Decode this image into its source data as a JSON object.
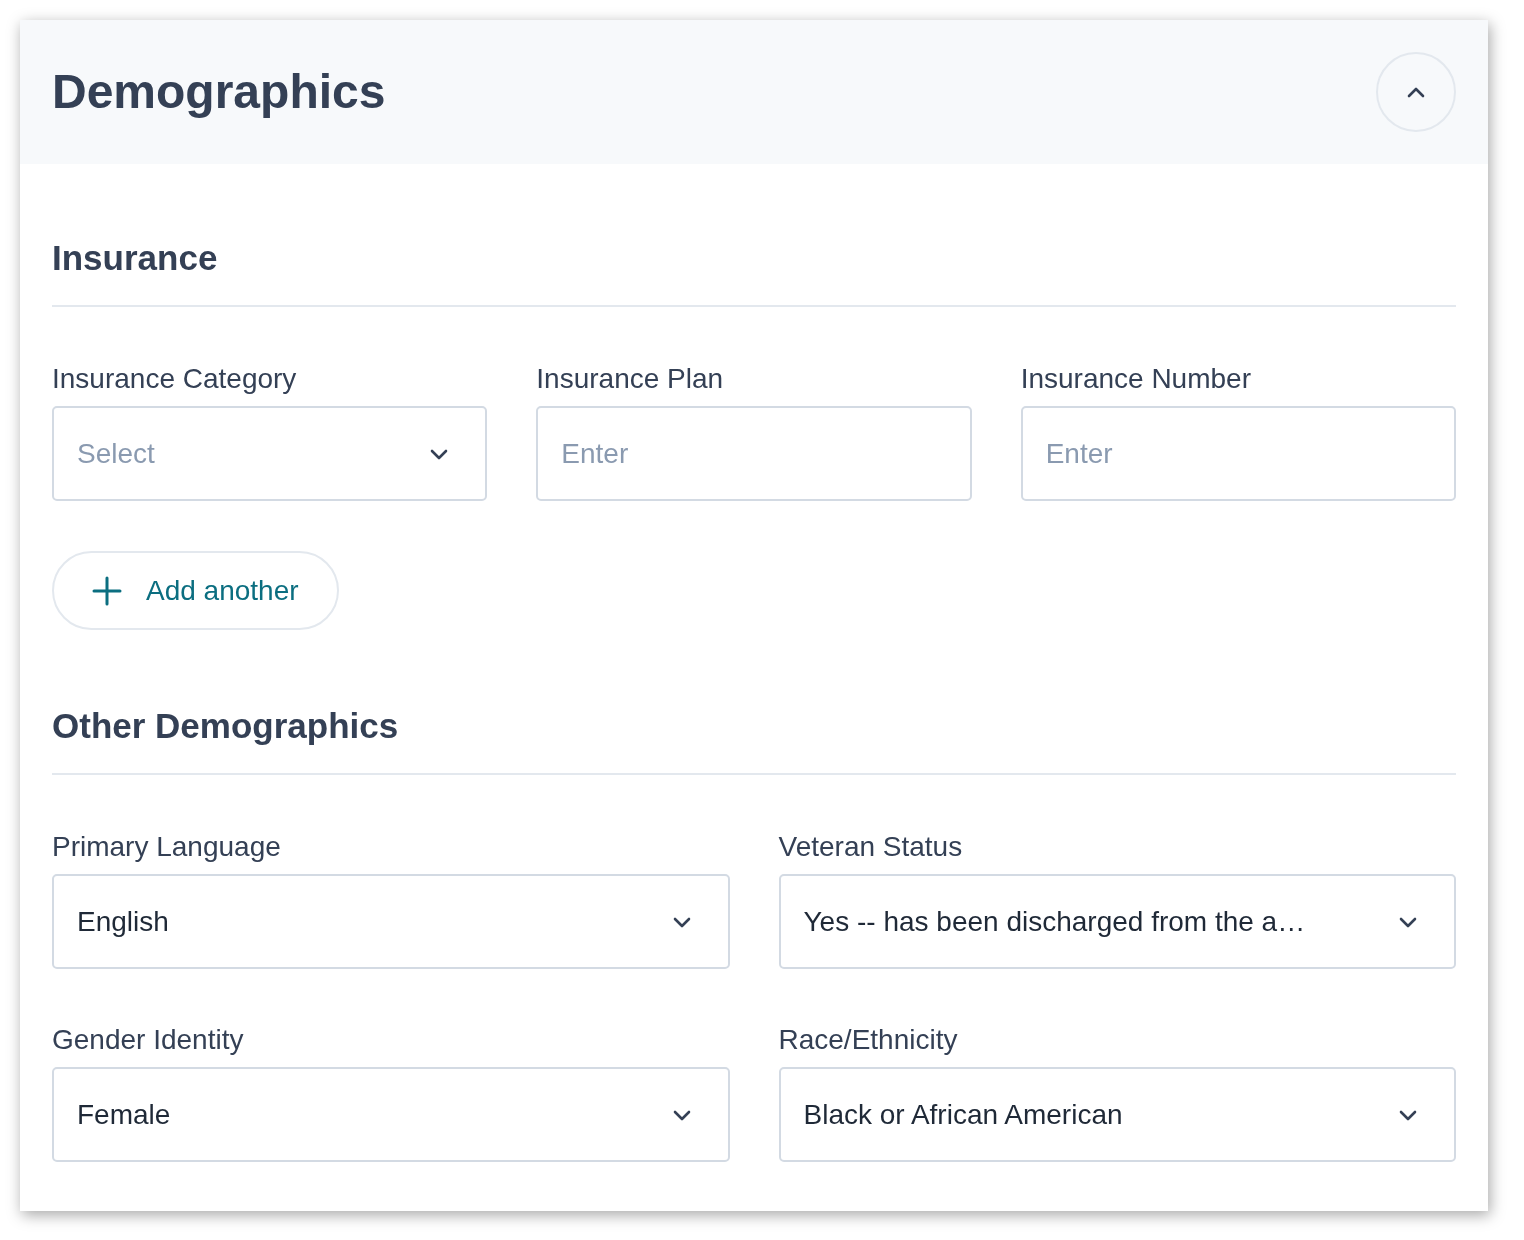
{
  "section": {
    "title": "Demographics",
    "expanded": true
  },
  "groups": [
    {
      "heading": "Insurance",
      "fields": [
        {
          "kind": "select",
          "label": "Insurance Category",
          "placeholder": "Select"
        },
        {
          "kind": "text",
          "label": "Insurance Plan",
          "placeholder": "Enter"
        },
        {
          "kind": "text",
          "label": "Insurance Number",
          "placeholder": "Enter"
        }
      ],
      "add_button": "Add another"
    },
    {
      "heading": "Other Demographics",
      "fields": [
        {
          "kind": "select",
          "label": "Primary Language",
          "value": "English"
        },
        {
          "kind": "select",
          "label": "Veteran Status",
          "value": "Yes -- has been discharged from the a…"
        },
        {
          "kind": "select",
          "label": "Gender Identity",
          "value": "Female"
        },
        {
          "kind": "select",
          "label": "Race/Ethnicity",
          "value": "Black or African American"
        }
      ]
    }
  ]
}
